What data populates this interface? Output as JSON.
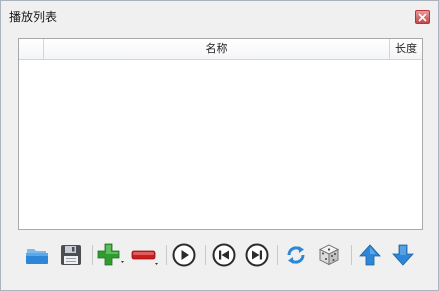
{
  "window": {
    "title": "播放列表",
    "close_icon": "close-icon"
  },
  "playlist": {
    "columns": [
      "",
      "名称",
      "长度"
    ],
    "rows": []
  },
  "toolbar": {
    "buttons": [
      {
        "name": "open-folder-button",
        "icon": "folder-icon"
      },
      {
        "name": "save-button",
        "icon": "floppy-disk-icon"
      },
      {
        "name": "add-button",
        "icon": "plus-icon"
      },
      {
        "name": "remove-button",
        "icon": "minus-icon"
      },
      {
        "name": "play-button",
        "icon": "play-icon"
      },
      {
        "name": "previous-button",
        "icon": "skip-previous-icon"
      },
      {
        "name": "next-button",
        "icon": "skip-next-icon"
      },
      {
        "name": "repeat-button",
        "icon": "repeat-icon"
      },
      {
        "name": "shuffle-button",
        "icon": "dice-icon"
      },
      {
        "name": "move-up-button",
        "icon": "arrow-up-icon"
      },
      {
        "name": "move-down-button",
        "icon": "arrow-down-icon"
      }
    ]
  },
  "colors": {
    "accent_blue": "#2e86d8",
    "add_green": "#2f9c2f",
    "remove_red": "#c81e1e"
  }
}
